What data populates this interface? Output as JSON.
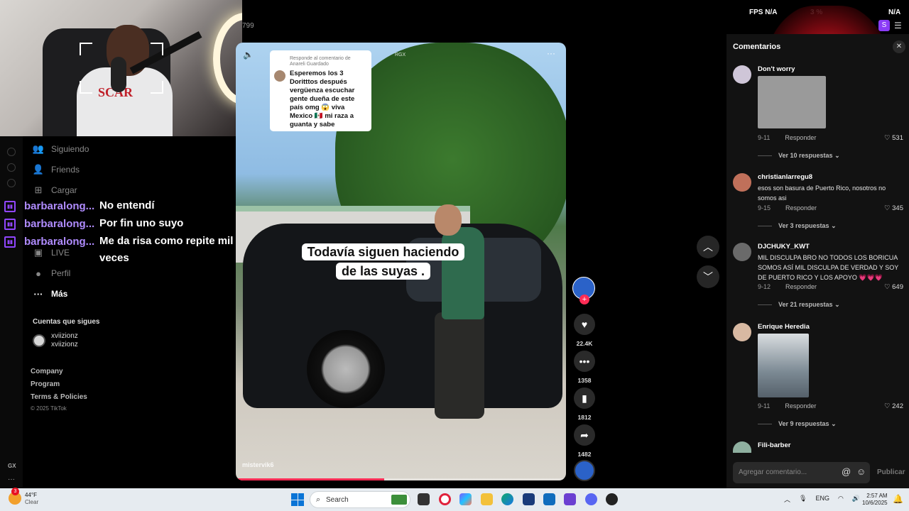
{
  "webcam": {
    "shirt_text": "SCAR"
  },
  "sidebar": {
    "items": [
      {
        "label": "Siguiendo",
        "icon": "following-icon"
      },
      {
        "label": "Friends",
        "icon": "friends-icon"
      },
      {
        "label": "Cargar",
        "icon": "upload-icon"
      },
      {
        "label": "LIVE",
        "icon": "live-icon"
      },
      {
        "label": "Perfil",
        "icon": "profile-icon"
      },
      {
        "label": "Más",
        "icon": "more-icon"
      }
    ],
    "following_header": "Cuentas que sigues",
    "following": [
      {
        "username": "xviizionz",
        "display": "xviizionz"
      }
    ],
    "footer": [
      "Company",
      "Program",
      "Terms & Policies"
    ],
    "copyright": "© 2025 TikTok",
    "rail_bottom": "GX"
  },
  "chat": {
    "platform_icon": "twitch-icon",
    "color": "#b08cff",
    "messages": [
      {
        "user": "barbaralong...",
        "text": "No entendí"
      },
      {
        "user": "barbaralong...",
        "text": "Por fin uno suyo"
      },
      {
        "user": "barbaralong...",
        "text": "Me da risa como repite mil veces"
      }
    ]
  },
  "topbar": {
    "counter": "799",
    "fps_label": "FPS",
    "fps_value": "N/A",
    "percent": "3 %",
    "right_na": "N/A",
    "profile_initial": "S"
  },
  "video": {
    "reply_header": "Responde al comentario de Anareli Guardado",
    "reply_text": "Esperemos los 3 Doritttos después vergüenza escuchar gente dueña de este país omg 😱 viva Mexico 🇲🇽 mi raza a guanta y sabe",
    "caption": "Todavía siguen haciendo de las suyas .",
    "tag": "RGX",
    "watermark": "mistervik6",
    "progress_fraction": 0.45
  },
  "actions": {
    "likes": "22.4K",
    "comments": "1358",
    "saves": "1812",
    "shares": "1482"
  },
  "comments_panel": {
    "title": "Comentarios",
    "input_placeholder": "Agregar comentario...",
    "publish": "Publicar",
    "reply_label": "Responder",
    "items": [
      {
        "name": "Don't worry",
        "text": "",
        "date": "9-11",
        "likes": "531",
        "more": "Ver 10 respuestas"
      },
      {
        "name": "christianlarregu8",
        "text": "esos son basura de Puerto Rico, nosotros no somos asi",
        "date": "9-15",
        "likes": "345",
        "more": "Ver 3 respuestas"
      },
      {
        "name": "DJCHUKY_KWT",
        "text": "MIL DISCULPA BRO NO TODOS LOS BORICUA SOMOS ASÍ MIL DISCULPA DE VERDAD Y SOY DE PUERTO RICO Y LOS APOYO 💗💗💗",
        "date": "9-12",
        "likes": "649",
        "more": "Ver 21 respuestas"
      },
      {
        "name": "Enrique Heredia",
        "text": "",
        "date": "9-11",
        "likes": "242",
        "more": "Ver 9 respuestas"
      },
      {
        "name": "Fili-barber",
        "text": "",
        "date": "",
        "likes": "",
        "more": ""
      }
    ]
  },
  "taskbar": {
    "temperature": "44°F",
    "condition": "Clear",
    "weather_badge": "3",
    "search_placeholder": "Search",
    "language": "ENG",
    "time": "2:57 AM",
    "date": "10/6/2025"
  }
}
